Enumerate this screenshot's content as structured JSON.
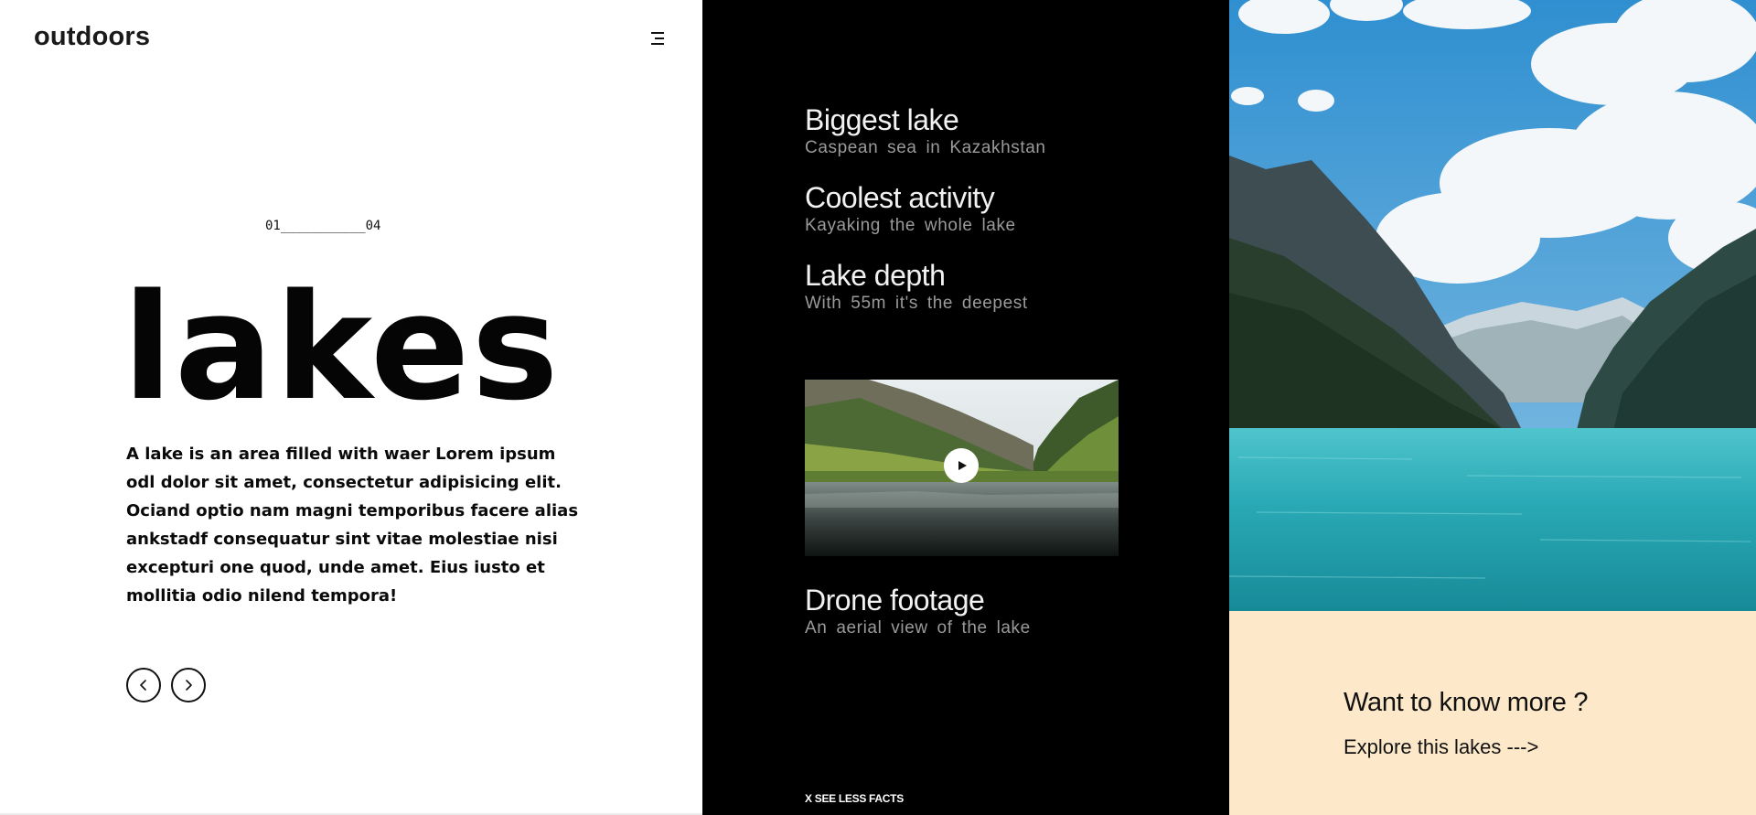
{
  "brand": {
    "name": "outdoors"
  },
  "header": {
    "menu_icon": "menu-icon"
  },
  "slider": {
    "counter": "01___________04"
  },
  "hero": {
    "title": "lakes",
    "description": "A lake is an area filled with waer Lorem ipsum odl dolor sit amet, consectetur adipisicing elit. Ociand optio nam magni temporibus facere alias ankstadf consequatur sint vitae molestiae nisi excepturi one quod, unde amet. Eius iusto et mollitia odio nilend tempora!"
  },
  "nav": {
    "prev_icon": "chevron-left-icon",
    "next_icon": "chevron-right-icon"
  },
  "facts": [
    {
      "title": "Biggest lake",
      "subtitle": "Caspean sea in Kazakhstan"
    },
    {
      "title": "Coolest activity",
      "subtitle": "Kayaking the whole lake"
    },
    {
      "title": "Lake depth",
      "subtitle": "With 55m it's the deepest"
    },
    {
      "title": "Drone footage",
      "subtitle": "An aerial view of the lake"
    }
  ],
  "video": {
    "play_icon": "play-icon"
  },
  "toggle": {
    "label": "X SEE LESS FACTS"
  },
  "cta": {
    "title": "Want to know more ?",
    "link": "Explore this lakes --->"
  },
  "colors": {
    "cta_background": "#fde9c9",
    "middle_background": "#000000",
    "subtitle_gray": "#9a9a9a"
  }
}
